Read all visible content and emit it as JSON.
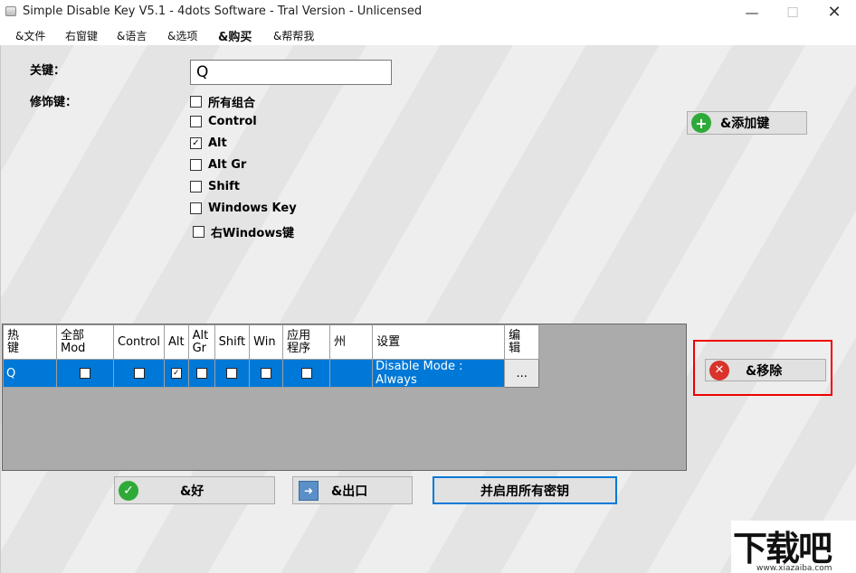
{
  "window": {
    "title": "Simple Disable Key V5.1 - 4dots Software - Tral Version - Unlicensed",
    "minimize": "—",
    "maximize": "☐",
    "close": "✕"
  },
  "menu": [
    "&文件",
    "右窗键",
    "&语言",
    "&选项",
    "&购买",
    "&帮帮我"
  ],
  "form": {
    "key_label": "关键：",
    "key_value": "Q",
    "modifier_label": "修饰键：",
    "modifiers": [
      {
        "label": "所有组合",
        "checked": false
      },
      {
        "label": "Control",
        "checked": false
      },
      {
        "label": "Alt",
        "checked": true
      },
      {
        "label": "Alt Gr",
        "checked": false
      },
      {
        "label": "Shift",
        "checked": false
      },
      {
        "label": "Windows Key",
        "checked": false
      },
      {
        "label": "右Windows键",
        "checked": false
      }
    ]
  },
  "buttons": {
    "add": "&添加键",
    "remove": "&移除",
    "ok": "&好",
    "exit": "&出口",
    "enable_all": "并启用所有密钥"
  },
  "grid": {
    "headers": [
      "热\n键",
      "全部\nMod",
      "Control",
      "Alt",
      "Alt\nGr",
      "Shift",
      "Win",
      "应用\n程序",
      "州",
      "设置",
      "编\n辑"
    ],
    "row": {
      "key": "Q",
      "all_mod": false,
      "control": false,
      "alt": true,
      "alt_gr": false,
      "shift": false,
      "win": false,
      "app": false,
      "state": "",
      "settings": "Disable Mode : Always",
      "edit": "..."
    }
  },
  "watermark": {
    "text": "下载吧",
    "url": "www.xiazaiba.com"
  },
  "colors": {
    "selection": "#0078d7",
    "highlight_box": "#e00000",
    "add_icon": "#2eaa38",
    "remove_icon": "#d9332b",
    "ok_icon": "#2eaa38"
  }
}
